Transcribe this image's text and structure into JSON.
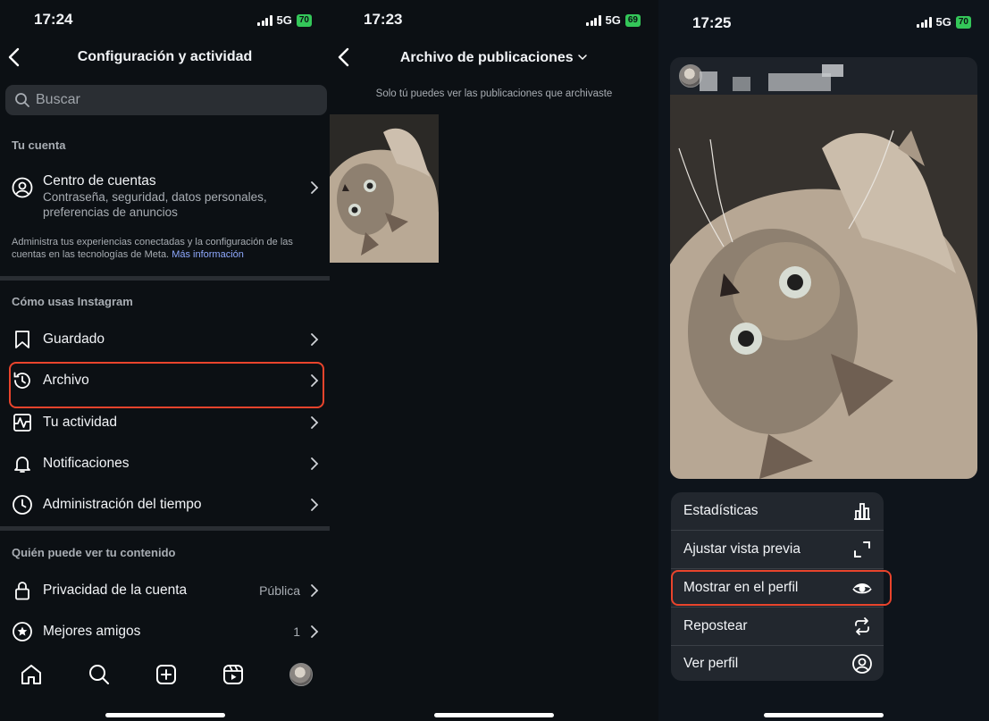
{
  "panel1": {
    "status": {
      "time": "17:24",
      "network": "5G",
      "battery": "70"
    },
    "header": {
      "title": "Configuración y actividad"
    },
    "search": {
      "placeholder": "Buscar"
    },
    "your_account": {
      "section_label": "Tu cuenta",
      "accounts_center": {
        "title": "Centro de cuentas",
        "subtitle": "Contraseña, seguridad, datos personales, preferencias de anuncios"
      },
      "meta_note": "Administra tus experiencias conectadas y la configuración de las cuentas en las tecnologías de Meta.",
      "meta_link": "Más información"
    },
    "how_you_use": {
      "section_label": "Cómo usas Instagram",
      "items": [
        {
          "label": "Guardado",
          "icon": "bookmark-icon"
        },
        {
          "label": "Archivo",
          "icon": "archive-clock-icon"
        },
        {
          "label": "Tu actividad",
          "icon": "activity-icon"
        },
        {
          "label": "Notificaciones",
          "icon": "bell-icon"
        },
        {
          "label": "Administración del tiempo",
          "icon": "clock-icon"
        }
      ]
    },
    "who_can_see": {
      "section_label": "Quién puede ver tu contenido",
      "items": [
        {
          "label": "Privacidad de la cuenta",
          "value": "Pública",
          "icon": "lock-icon"
        },
        {
          "label": "Mejores amigos",
          "value": "1",
          "icon": "star-circle-icon"
        }
      ]
    },
    "bottom_nav": [
      "home-icon",
      "search-icon",
      "create-icon",
      "reels-icon",
      "profile-avatar"
    ],
    "highlight_color": "#e9442c"
  },
  "panel2": {
    "status": {
      "time": "17:23",
      "network": "5G",
      "battery": "69"
    },
    "header": {
      "title": "Archivo de publicaciones"
    },
    "note": "Solo tú puedes ver las publicaciones que archivaste"
  },
  "panel3": {
    "status": {
      "time": "17:25",
      "network": "5G",
      "battery": "70"
    },
    "menu": [
      {
        "label": "Estadísticas",
        "icon": "bar-chart-icon"
      },
      {
        "label": "Ajustar vista previa",
        "icon": "crop-corners-icon"
      },
      {
        "label": "Mostrar en el perfil",
        "icon": "eye-icon"
      },
      {
        "label": "Repostear",
        "icon": "repost-icon"
      },
      {
        "label": "Ver perfil",
        "icon": "user-circle-icon"
      }
    ]
  },
  "colors": {
    "background": "#0c1014",
    "accent_link": "#8fa9ff",
    "highlight": "#e9442c",
    "battery": "#34c759"
  }
}
